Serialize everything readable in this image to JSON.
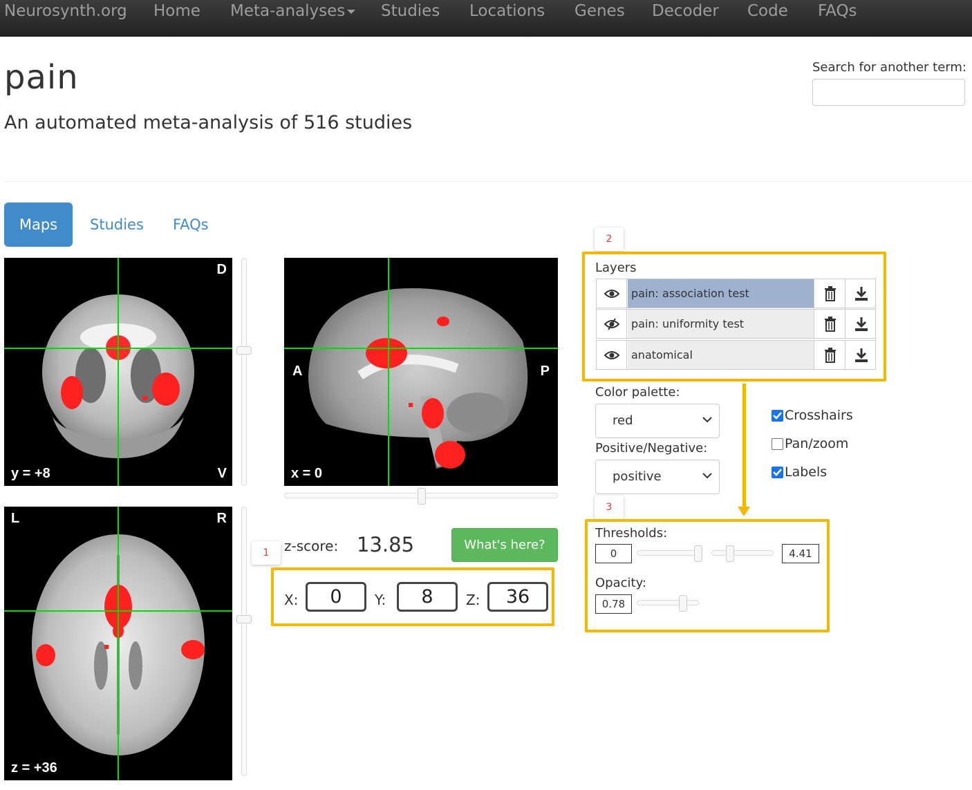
{
  "nav": {
    "brand": "Neurosynth.org",
    "items": [
      "Home",
      "Meta-analyses",
      "Studies",
      "Locations",
      "Genes",
      "Decoder",
      "Code",
      "FAQs"
    ]
  },
  "page": {
    "title": "pain",
    "subtitle": "An automated meta-analysis of 516 studies"
  },
  "search": {
    "label": "Search for another term:",
    "value": ""
  },
  "tabs": [
    "Maps",
    "Studies",
    "FAQs"
  ],
  "viewers": {
    "coronal": {
      "top_right": "D",
      "bottom_left": "y = +8",
      "bottom_right": "V"
    },
    "sagittal": {
      "left": "A",
      "right": "P",
      "bottom_left": "x = 0"
    },
    "axial": {
      "top_left": "L",
      "top_right": "R",
      "bottom_left": "z = +36"
    }
  },
  "zscore": {
    "label": "z-score:",
    "value": "13.85"
  },
  "whats_here": "What's here?",
  "coords": {
    "x_label": "X:",
    "x": "0",
    "y_label": "Y:",
    "y": "8",
    "z_label": "Z:",
    "z": "36"
  },
  "badges": [
    "1",
    "2",
    "3"
  ],
  "layers": {
    "label": "Layers",
    "items": [
      {
        "name": "pain: association test",
        "visible": true,
        "selected": true
      },
      {
        "name": "pain: uniformity test",
        "visible": false,
        "selected": false
      },
      {
        "name": "anatomical",
        "visible": true,
        "selected": false
      }
    ]
  },
  "color_palette": {
    "label": "Color palette:",
    "value": "red"
  },
  "posneg": {
    "label": "Positive/Negative:",
    "value": "positive"
  },
  "options": [
    {
      "label": "Crosshairs",
      "checked": true
    },
    {
      "label": "Pan/zoom",
      "checked": false
    },
    {
      "label": "Labels",
      "checked": true
    }
  ],
  "thresholds": {
    "label": "Thresholds:",
    "min": "0",
    "max": "4.41"
  },
  "opacity": {
    "label": "Opacity:",
    "value": "0.78"
  },
  "colors": {
    "accent": "#428bca",
    "highlight": "#f5b800",
    "activation": "#ff2020",
    "crosshair": "#00dd00",
    "button": "#5cb85c"
  }
}
